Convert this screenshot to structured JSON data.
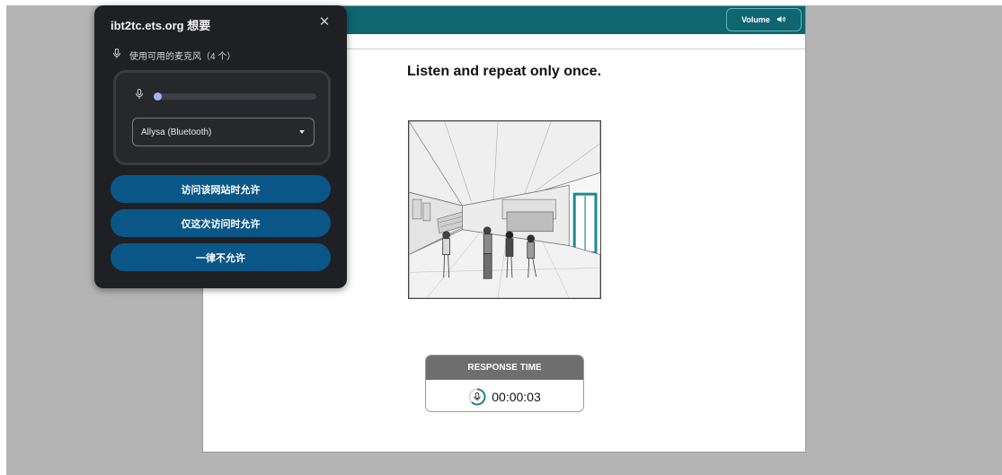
{
  "page": {
    "instruction": "Listen and repeat only once.",
    "picture_icon": "lobby-illustration",
    "volume_label": "Volume",
    "volume_icon": "speaker-icon",
    "response_time": {
      "label": "RESPONSE TIME",
      "value": "00:00:03",
      "icon": "microphone-icon"
    }
  },
  "popup": {
    "title": "ibt2tc.ets.org 想要",
    "close_icon": "close-icon",
    "mic_permission": "使用可用的麦克风（4 个）",
    "device_name": "Allysa (Bluetooth)",
    "mic_level": 0.02,
    "buttons": {
      "allow_while_visiting": "访问该网站时允许",
      "allow_this_time": "仅这次访问时允许",
      "never_allow": "一律不允许"
    }
  },
  "colors": {
    "topbar": "#0f6570",
    "popup_bg": "#1f2023",
    "popup_button": "#0a5686",
    "accent_teal": "#1a8a8d",
    "level_fill": "#9bb8f5"
  }
}
